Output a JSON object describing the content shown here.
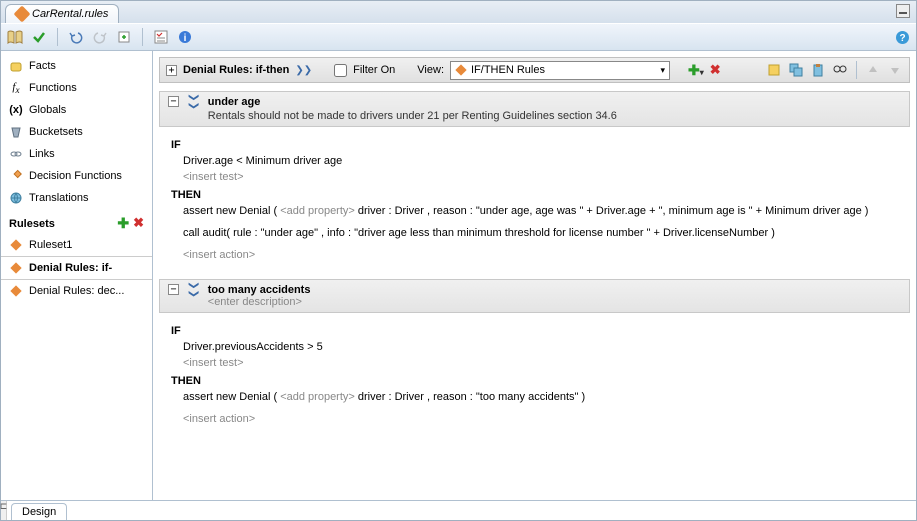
{
  "tab": {
    "title": "CarRental.rules"
  },
  "toolbar": {},
  "sidebar": {
    "items": [
      {
        "label": "Facts"
      },
      {
        "label": "Functions"
      },
      {
        "label": "Globals"
      },
      {
        "label": "Bucketsets"
      },
      {
        "label": "Links"
      },
      {
        "label": "Decision Functions"
      },
      {
        "label": "Translations"
      }
    ],
    "rulesets_label": "Rulesets",
    "rulesets": [
      {
        "label": "Ruleset1"
      },
      {
        "label": "Denial Rules: if-"
      },
      {
        "label": "Denial Rules: dec..."
      }
    ]
  },
  "ruleToolbar": {
    "title": "Denial Rules: if-then",
    "filter_label": "Filter On",
    "view_label": "View:",
    "view_value": "IF/THEN Rules"
  },
  "rules": [
    {
      "name": "under age",
      "desc": "Rentals should not be made to drivers under 21 per Renting Guidelines section 34.6",
      "if_kw": "IF",
      "condition": "Driver.age  <  Minimum driver age",
      "insert_test": "<insert test>",
      "then_kw": "THEN",
      "action1_pre": "assert new Denial (   ",
      "action1_addprop": "<add property>",
      "action1_post": "  driver : Driver , reason : \"under age, age was \" + Driver.age + \", minimum age is \" + Minimum driver age  )",
      "action2": "call audit( rule : \"under age\" , info : \"driver age less than minimum threshold for license number \" + Driver.licenseNumber )",
      "insert_action": "<insert action>"
    },
    {
      "name": "too many accidents",
      "desc_placeholder": "<enter description>",
      "if_kw": "IF",
      "condition": "Driver.previousAccidents  >  5",
      "insert_test": "<insert test>",
      "then_kw": "THEN",
      "action1_pre": "assert new Denial (   ",
      "action1_addprop": "<add property>",
      "action1_post": "   driver : Driver , reason : \"too many accidents\"  )",
      "insert_action": "<insert action>"
    }
  ],
  "footer": {
    "design": "Design"
  }
}
